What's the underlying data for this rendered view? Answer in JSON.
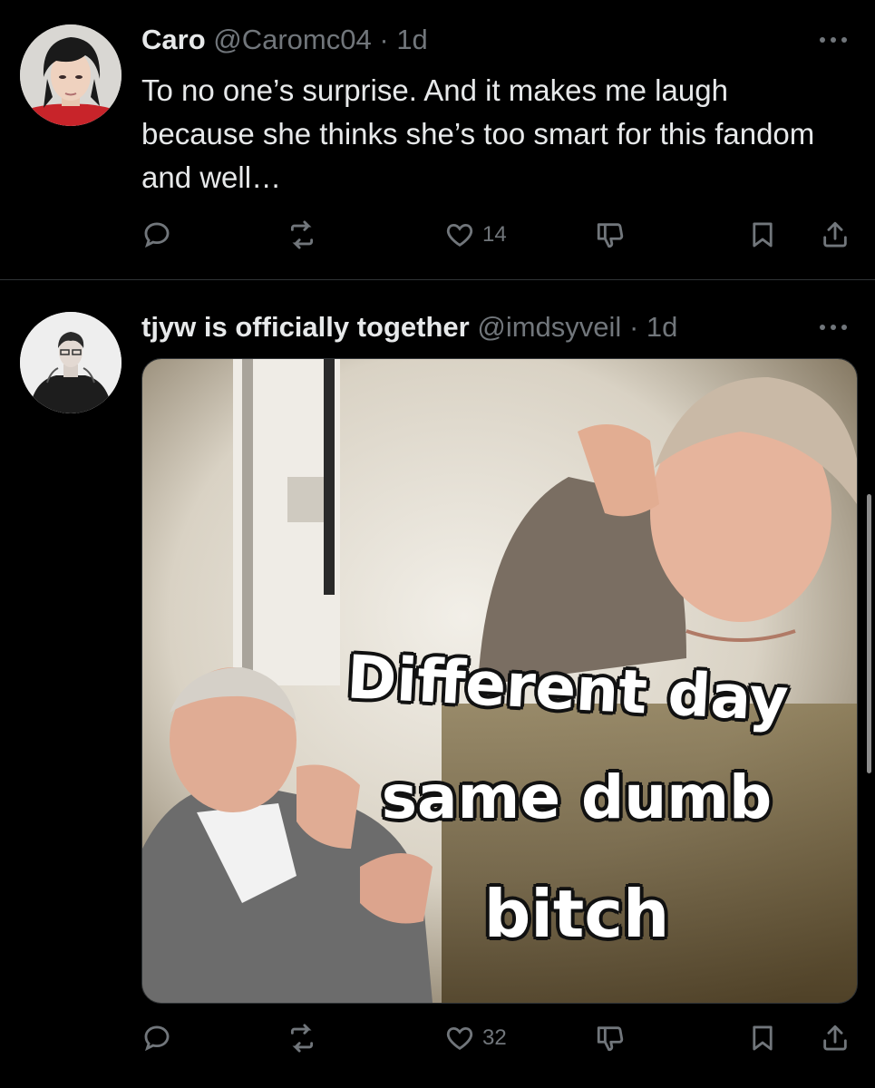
{
  "tweets": [
    {
      "name": "Caro",
      "handle": "@Caromc04",
      "dot": "·",
      "time": "1d",
      "text": "To no one’s surprise. And it makes me laugh because she thinks she’s too smart for this fandom and well…",
      "likes": "14",
      "replies": "",
      "reposts": ""
    },
    {
      "name": "tjyw is officially together",
      "handle": "@imdsyveil",
      "dot": "·",
      "time": "1d",
      "media": {
        "caption_line1": "Different day",
        "caption_line2": "same dumb",
        "caption_line3": "bitch"
      },
      "likes": "32",
      "replies": "",
      "reposts": ""
    }
  ],
  "icons": {
    "reply": "reply-icon",
    "repost": "repost-icon",
    "like": "heart-icon",
    "dislike": "dislike-icon",
    "bookmark": "bookmark-icon",
    "share": "share-icon",
    "more": "more-icon"
  },
  "colors": {
    "background": "#000000",
    "text": "#e7e9ea",
    "muted": "#71767b",
    "divider": "#2f3336"
  }
}
